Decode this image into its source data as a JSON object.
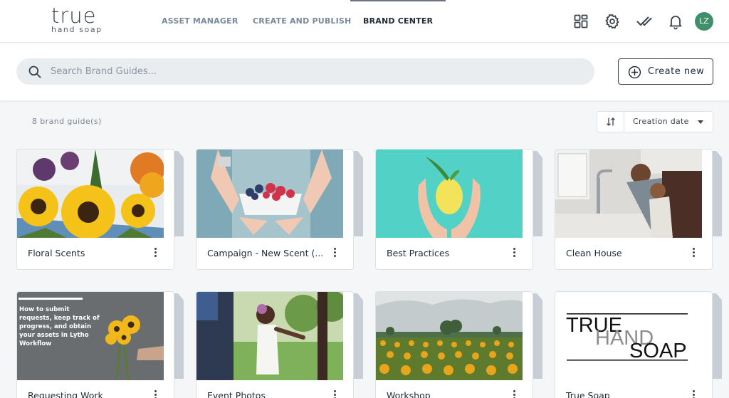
{
  "brand": {
    "logo_main": "true",
    "logo_sub": "hand soap"
  },
  "nav": {
    "tabs": [
      {
        "label": "ASSET MANAGER",
        "active": false
      },
      {
        "label": "CREATE AND PUBLISH",
        "active": false
      },
      {
        "label": "BRAND CENTER",
        "active": true
      }
    ]
  },
  "toolbar": {
    "icons": [
      "apps-grid-icon",
      "gear-icon",
      "double-check-icon",
      "bell-icon"
    ],
    "avatar_initials": "LZ",
    "avatar_color": "#3f8f6b"
  },
  "search": {
    "placeholder": "Search Brand Guides...",
    "value": ""
  },
  "create_button": {
    "label": "Create new"
  },
  "listing": {
    "count_label": "8 brand guide(s)",
    "sort": {
      "selected": "Creation date"
    }
  },
  "guides": [
    {
      "title": "Floral Scents",
      "thumb": "sunflowers-bouquet"
    },
    {
      "title": "Campaign - New Scent (...",
      "thumb": "berries-bowl"
    },
    {
      "title": "Best Practices",
      "thumb": "lemon-in-hands"
    },
    {
      "title": "Clean House",
      "thumb": "handwashing-kitchen"
    },
    {
      "title": "Requesting Work",
      "thumb": "workflow-cover",
      "thumb_text": "How to submit requests, keep track of progress, and obtain your assets in Lytho Workflow"
    },
    {
      "title": "Event Photos",
      "thumb": "child-walking"
    },
    {
      "title": "Workshop",
      "thumb": "sunflower-field"
    },
    {
      "title": "True Soap",
      "thumb": "wordmark",
      "thumb_text": [
        "TRUE",
        "HAND",
        "SOAP"
      ]
    }
  ],
  "colors": {
    "accent": "#1f2a37",
    "page_bg": "#f4f6f8",
    "stack": "#c7ced6"
  }
}
